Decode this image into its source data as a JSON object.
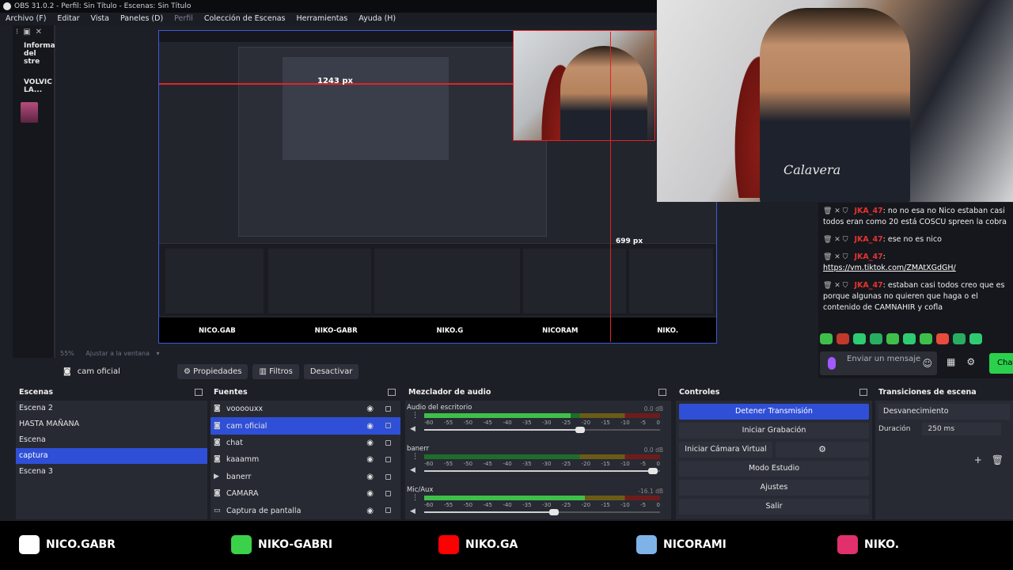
{
  "window": {
    "title": "OBS 31.0.2 - Perfil: Sin Título - Escenas: Sin Título"
  },
  "menu": [
    {
      "label": "Archivo (F)",
      "dim": false
    },
    {
      "label": "Editar",
      "dim": false
    },
    {
      "label": "Vista",
      "dim": false
    },
    {
      "label": "Paneles (D)",
      "dim": false
    },
    {
      "label": "Perfil",
      "dim": true
    },
    {
      "label": "Colección de Escenas",
      "dim": false
    },
    {
      "label": "Herramientas",
      "dim": false
    },
    {
      "label": "Ayuda (H)",
      "dim": false
    }
  ],
  "left_dock": {
    "line1": "Informa",
    "line2": "del stre",
    "line3": "VOLVIC",
    "line4": "LA..."
  },
  "preview": {
    "px_label": "1243 px",
    "px_label2": "699 px",
    "zoom": "55%",
    "fit_label": "Ajustar a la ventana"
  },
  "source_toolbar": {
    "current_source": "cam oficial",
    "properties": "Propiedades",
    "filters": "Filtros",
    "deactivate": "Desactivar"
  },
  "scenes": {
    "title": "Escenas",
    "items": [
      "Escena 2",
      "HASTA MAÑANA",
      "Escena",
      "captura",
      "Escena 3"
    ],
    "selected": 3
  },
  "sources": {
    "title": "Fuentes",
    "items": [
      {
        "label": "voooouxx",
        "icon": "camera-icon"
      },
      {
        "label": "cam oficial",
        "icon": "camera-icon"
      },
      {
        "label": "chat",
        "icon": "browser-icon"
      },
      {
        "label": "kaaamm",
        "icon": "camera-icon"
      },
      {
        "label": "banerr",
        "icon": "play-icon"
      },
      {
        "label": "CAMARA",
        "icon": "camera-icon"
      },
      {
        "label": "Captura de pantalla",
        "icon": "monitor-icon"
      }
    ],
    "selected": 1
  },
  "mixer": {
    "title": "Mezclador de audio",
    "scale": [
      "-60",
      "-55",
      "-50",
      "-45",
      "-40",
      "-35",
      "-30",
      "-25",
      "-20",
      "-15",
      "-10",
      "-5",
      "0"
    ],
    "channels": [
      {
        "name": "Audio del escritorio",
        "db": "0.0 dB",
        "level": 0.62,
        "fader": 0.66
      },
      {
        "name": "banerr",
        "db": "0.0 dB",
        "level": 0.0,
        "fader": 0.97
      },
      {
        "name": "Mic/Aux",
        "db": "-16.1 dB",
        "level": 0.68,
        "fader": 0.55
      }
    ]
  },
  "controls": {
    "title": "Controles",
    "stop_stream": "Detener Transmisión",
    "start_record": "Iniciar Grabación",
    "virtual_cam": "Iniciar Cámara Virtual",
    "studio_mode": "Modo Estudio",
    "settings": "Ajustes",
    "exit": "Salir"
  },
  "transitions": {
    "title": "Transiciones de escena",
    "selected": "Desvanecimiento",
    "duration_label": "Duración",
    "duration_value": "250 ms"
  },
  "chat": {
    "messages": [
      {
        "user": "JKA_47",
        "text": ": no no esa no Nico estaban casi todos eran como 20 está COSCU spreen la cobra",
        "link": ""
      },
      {
        "user": "JKA_47",
        "text": ": ese no es nico",
        "link": ""
      },
      {
        "user": "JKA_47",
        "text": ":",
        "link": "https://vm.tiktok.com/ZMAtXGdGH/"
      },
      {
        "user": "JKA_47",
        "text": ": estaban casi todos creo que es porque algunas no quieren que haga o el contenido de CAMNAHIR y cofla",
        "link": ""
      }
    ],
    "input_placeholder": "Enviar un mensaje",
    "send_button": "Chat"
  },
  "hoodie_text": "Calavera",
  "mini_ticker": [
    "NICO.GAB",
    "NIKO-GABR",
    "NIKO.G",
    "NICORAM",
    "NIKO."
  ],
  "ticker": [
    {
      "label": "NICO.GABR",
      "color": "#ffffff"
    },
    {
      "label": "NIKO-GABRI",
      "color": "#3bd14a"
    },
    {
      "label": "NIKO.GA",
      "color": "#ff0000"
    },
    {
      "label": "NICORAMI",
      "color": "#7fb3e8"
    },
    {
      "label": "NIKO.",
      "color": "#e1306c"
    }
  ],
  "colors": {
    "accent": "#2f4fd6",
    "marker": "#e02424",
    "chat_user": "#e3342f"
  }
}
